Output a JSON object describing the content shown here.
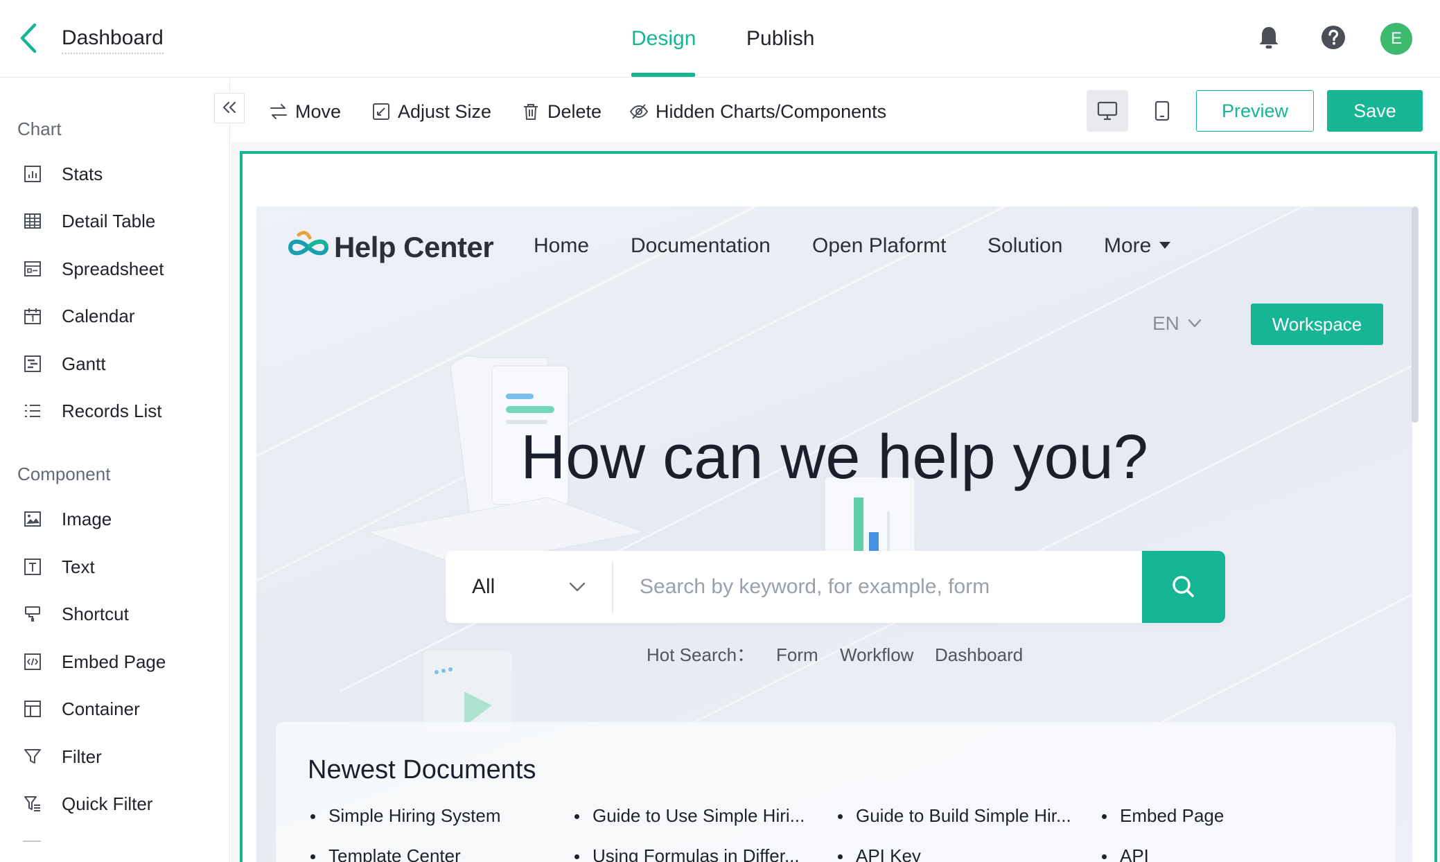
{
  "topbar": {
    "title": "Dashboard",
    "tabs": [
      {
        "label": "Design",
        "active": true
      },
      {
        "label": "Publish",
        "active": false
      }
    ],
    "avatar_initial": "E"
  },
  "sidebar": {
    "chart_section": "Chart",
    "chart_items": [
      {
        "label": "Stats",
        "icon": "stats-icon"
      },
      {
        "label": "Detail Table",
        "icon": "table-icon"
      },
      {
        "label": "Spreadsheet",
        "icon": "spreadsheet-icon"
      },
      {
        "label": "Calendar",
        "icon": "calendar-icon"
      },
      {
        "label": "Gantt",
        "icon": "gantt-icon"
      },
      {
        "label": "Records List",
        "icon": "list-icon"
      }
    ],
    "component_section": "Component",
    "component_items": [
      {
        "label": "Image",
        "icon": "image-icon"
      },
      {
        "label": "Text",
        "icon": "text-icon"
      },
      {
        "label": "Shortcut",
        "icon": "shortcut-icon"
      },
      {
        "label": "Embed Page",
        "icon": "embed-icon"
      },
      {
        "label": "Container",
        "icon": "container-icon"
      },
      {
        "label": "Filter",
        "icon": "filter-icon"
      },
      {
        "label": "Quick Filter",
        "icon": "quick-filter-icon"
      }
    ]
  },
  "toolbar": {
    "move": "Move",
    "adjust_size": "Adjust Size",
    "delete": "Delete",
    "hidden": "Hidden Charts/Components",
    "preview": "Preview",
    "save": "Save"
  },
  "embed": {
    "brand": "Help Center",
    "nav": [
      "Home",
      "Documentation",
      "Open Plaformt",
      "Solution",
      "More"
    ],
    "language": "EN",
    "workspace": "Workspace",
    "hero": "How can we help you?",
    "search": {
      "scope": "All",
      "placeholder": "Search by keyword, for example, form"
    },
    "hot_search_label": "Hot Search：",
    "hot_links": [
      "Form",
      "Workflow",
      "Dashboard"
    ],
    "newest_title": "Newest Documents",
    "docs": [
      "Simple Hiring System",
      "Guide to Use Simple Hiri...",
      "Guide to Build Simple Hir...",
      "Embed Page",
      "Template Center",
      "Using Formulas in Differ...",
      "API Key",
      "API"
    ]
  },
  "colors": {
    "accent": "#16b596",
    "avatar": "#3dba6e",
    "text": "#1f2329"
  }
}
